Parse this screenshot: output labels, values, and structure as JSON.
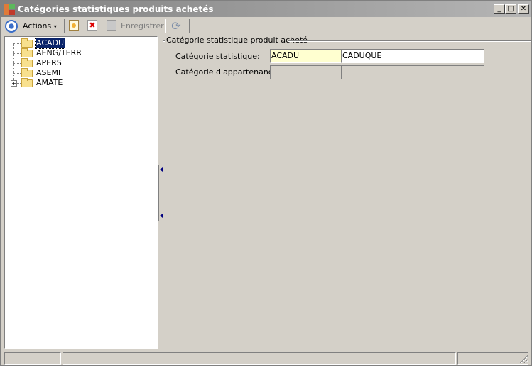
{
  "window": {
    "title": "Catégories statistiques produits achetés",
    "min_glyph": "_",
    "max_glyph": "□",
    "close_glyph": "✕"
  },
  "toolbar": {
    "actions_label": "Actions",
    "actions_caret": "▾",
    "delete_glyph": "✖",
    "save_label": "Enregistrer",
    "refresh_glyph": "⟳",
    "icons": [
      "globe-icon",
      "new-record-icon",
      "delete-icon",
      "save-icon",
      "refresh-icon"
    ]
  },
  "tree": {
    "items": [
      {
        "label": "ACADU",
        "selected": true,
        "expandable": false
      },
      {
        "label": "AENG/TERR",
        "selected": false,
        "expandable": false
      },
      {
        "label": "APERS",
        "selected": false,
        "expandable": false
      },
      {
        "label": "ASEMI",
        "selected": false,
        "expandable": false
      },
      {
        "label": "AMATE",
        "selected": false,
        "expandable": true,
        "expander_glyph": "+"
      }
    ]
  },
  "form": {
    "group_title": "Catégorie statistique produit acheté",
    "stat_category_label": "Catégorie statistique:",
    "stat_category_code": "ACADU",
    "stat_category_desc": "CADUQUE",
    "parent_category_label": "Catégorie d'appartenance:",
    "parent_category_code": "",
    "parent_category_desc": ""
  },
  "colors": {
    "selection": "#0a246a",
    "required_field": "#ffffd0"
  }
}
